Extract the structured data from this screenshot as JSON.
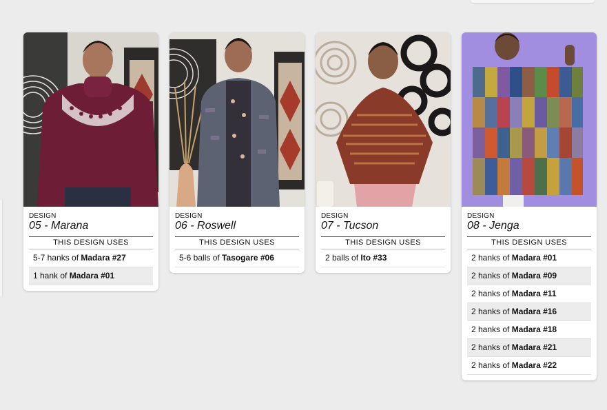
{
  "label_design": "DESIGN",
  "label_uses": "THIS DESIGN USES",
  "designs": [
    {
      "name": "05 - Marana",
      "yarns": [
        {
          "qty": "5-7 hanks of",
          "yarn": "Madara #27"
        },
        {
          "qty": "1 hank of",
          "yarn": "Madara #01"
        }
      ]
    },
    {
      "name": "06 - Roswell",
      "yarns": [
        {
          "qty": "5-6 balls of",
          "yarn": "Tasogare #06"
        }
      ]
    },
    {
      "name": "07 - Tucson",
      "yarns": [
        {
          "qty": "2 balls of",
          "yarn": "Ito #33"
        }
      ]
    },
    {
      "name": "08 - Jenga",
      "yarns": [
        {
          "qty": "2 hanks of",
          "yarn": "Madara #01"
        },
        {
          "qty": "2 hanks of",
          "yarn": "Madara #09"
        },
        {
          "qty": "2 hanks of",
          "yarn": "Madara #11"
        },
        {
          "qty": "2 hanks of",
          "yarn": "Madara #16"
        },
        {
          "qty": "2 hanks of",
          "yarn": "Madara #18"
        },
        {
          "qty": "2 hanks of",
          "yarn": "Madara #21"
        },
        {
          "qty": "2 hanks of",
          "yarn": "Madara #22"
        }
      ]
    }
  ],
  "colors": {
    "page_bg": "#ececec",
    "card_bg": "#ffffff",
    "row_alt": "#ececec"
  }
}
